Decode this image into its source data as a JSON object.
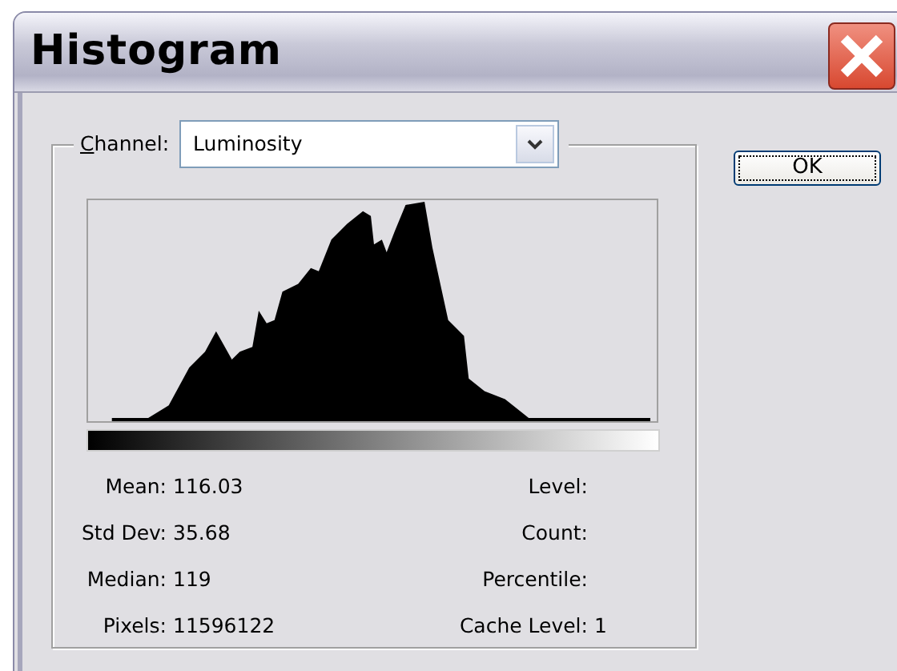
{
  "window": {
    "title": "Histogram"
  },
  "channel": {
    "label": "Channel:",
    "value": "Luminosity"
  },
  "buttons": [
    "OK"
  ],
  "stats_left": [
    {
      "label": "Mean:",
      "value": "116.03"
    },
    {
      "label": "Std Dev:",
      "value": "35.68"
    },
    {
      "label": "Median:",
      "value": "119"
    },
    {
      "label": "Pixels:",
      "value": "11596122"
    }
  ],
  "stats_right": [
    {
      "label": "Level:"
    },
    {
      "label": "Count:"
    },
    {
      "label": "Percentile:"
    },
    {
      "label": "Cache Level:",
      "value": "1"
    }
  ]
}
